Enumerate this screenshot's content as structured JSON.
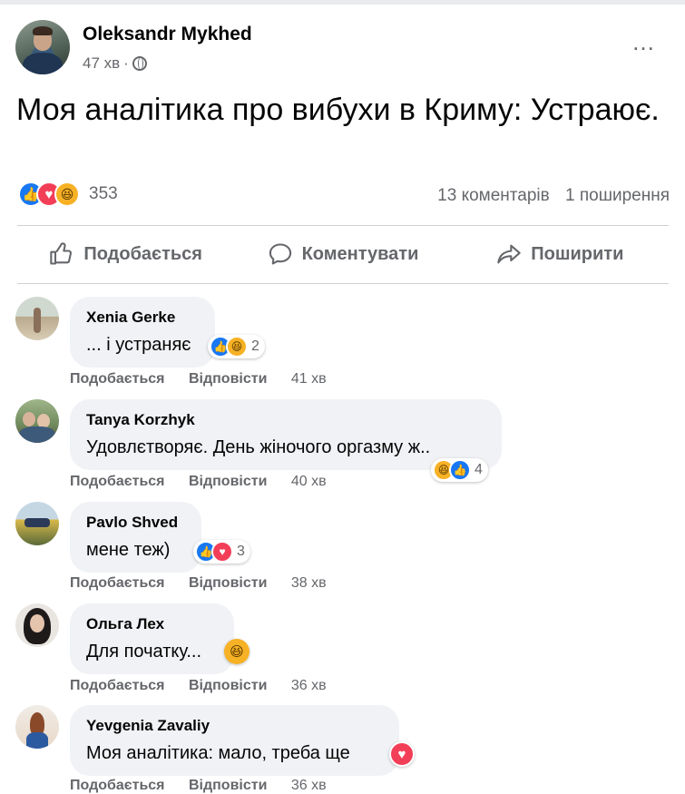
{
  "post": {
    "author": "Oleksandr Mykhed",
    "time": "47 хв",
    "separator": "·",
    "text": "Моя аналітика про вибухи в Криму: Устраює.",
    "reaction_count": "353",
    "comments_count": "13 коментарів",
    "shares_count": "1 поширення",
    "more_icon": "…"
  },
  "actions": {
    "like": "Подобається",
    "comment": "Коментувати",
    "share": "Поширити"
  },
  "icons": {
    "like": "like-icon",
    "love": "love-icon",
    "haha": "haha-icon",
    "globe": "globe-icon"
  },
  "colors": {
    "like": "#1877f2",
    "love": "#f33e58",
    "haha": "#f7b125",
    "bubble": "#f0f2f5",
    "secondary_text": "#65676b"
  },
  "comments": [
    {
      "name": "Xenia Gerke",
      "text": "... і устраняє",
      "like": "Подобається",
      "reply": "Відповісти",
      "time": "41 хв",
      "reactions": "2"
    },
    {
      "name": "Tanya Korzhyk",
      "text": "Удовлєтворяє. День жіночого оргазму ж..",
      "like": "Подобається",
      "reply": "Відповісти",
      "time": "40 хв",
      "reactions": "4"
    },
    {
      "name": "Pavlo Shved",
      "text": "мене теж)",
      "like": "Подобається",
      "reply": "Відповісти",
      "time": "38 хв",
      "reactions": "3"
    },
    {
      "name": "Ольга Лех",
      "text": "Для початку...",
      "like": "Подобається",
      "reply": "Відповісти",
      "time": "36 хв"
    },
    {
      "name": "Yevgenia Zavaliy",
      "text": "Моя аналітика: мало, треба ще",
      "like": "Подобається",
      "reply": "Відповісти",
      "time": "36 хв"
    }
  ]
}
